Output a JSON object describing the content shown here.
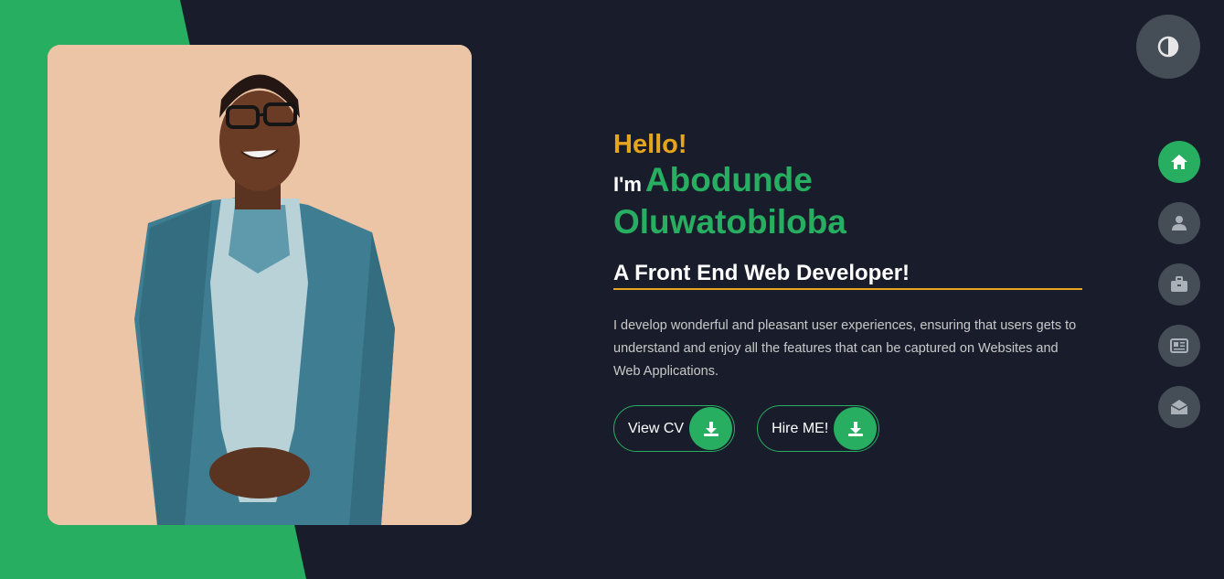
{
  "colors": {
    "background": "#191d2b",
    "accent_green": "#27ae60",
    "accent_gold": "#e7a51c",
    "icon_grey": "#454e56"
  },
  "hero": {
    "greeting": "Hello!",
    "intro": "I'm",
    "name_first": "Abodunde",
    "name_last": "Oluwatobiloba",
    "role": "A Front End Web Developer!",
    "description": "I develop wonderful and pleasant user experiences, ensuring that users gets to understand and enjoy all the features that can be captured on Websites and Web Applications."
  },
  "actions": {
    "view_cv_label": "View CV",
    "view_cv_icon": "download-icon",
    "hire_me_label": "Hire ME!",
    "hire_me_icon": "download-icon"
  },
  "theme_toggle": {
    "icon": "contrast-icon"
  },
  "nav": {
    "items": [
      {
        "icon": "home-icon",
        "active": true
      },
      {
        "icon": "user-icon",
        "active": false
      },
      {
        "icon": "briefcase-icon",
        "active": false
      },
      {
        "icon": "newspaper-icon",
        "active": false
      },
      {
        "icon": "envelope-open-icon",
        "active": false
      }
    ]
  }
}
